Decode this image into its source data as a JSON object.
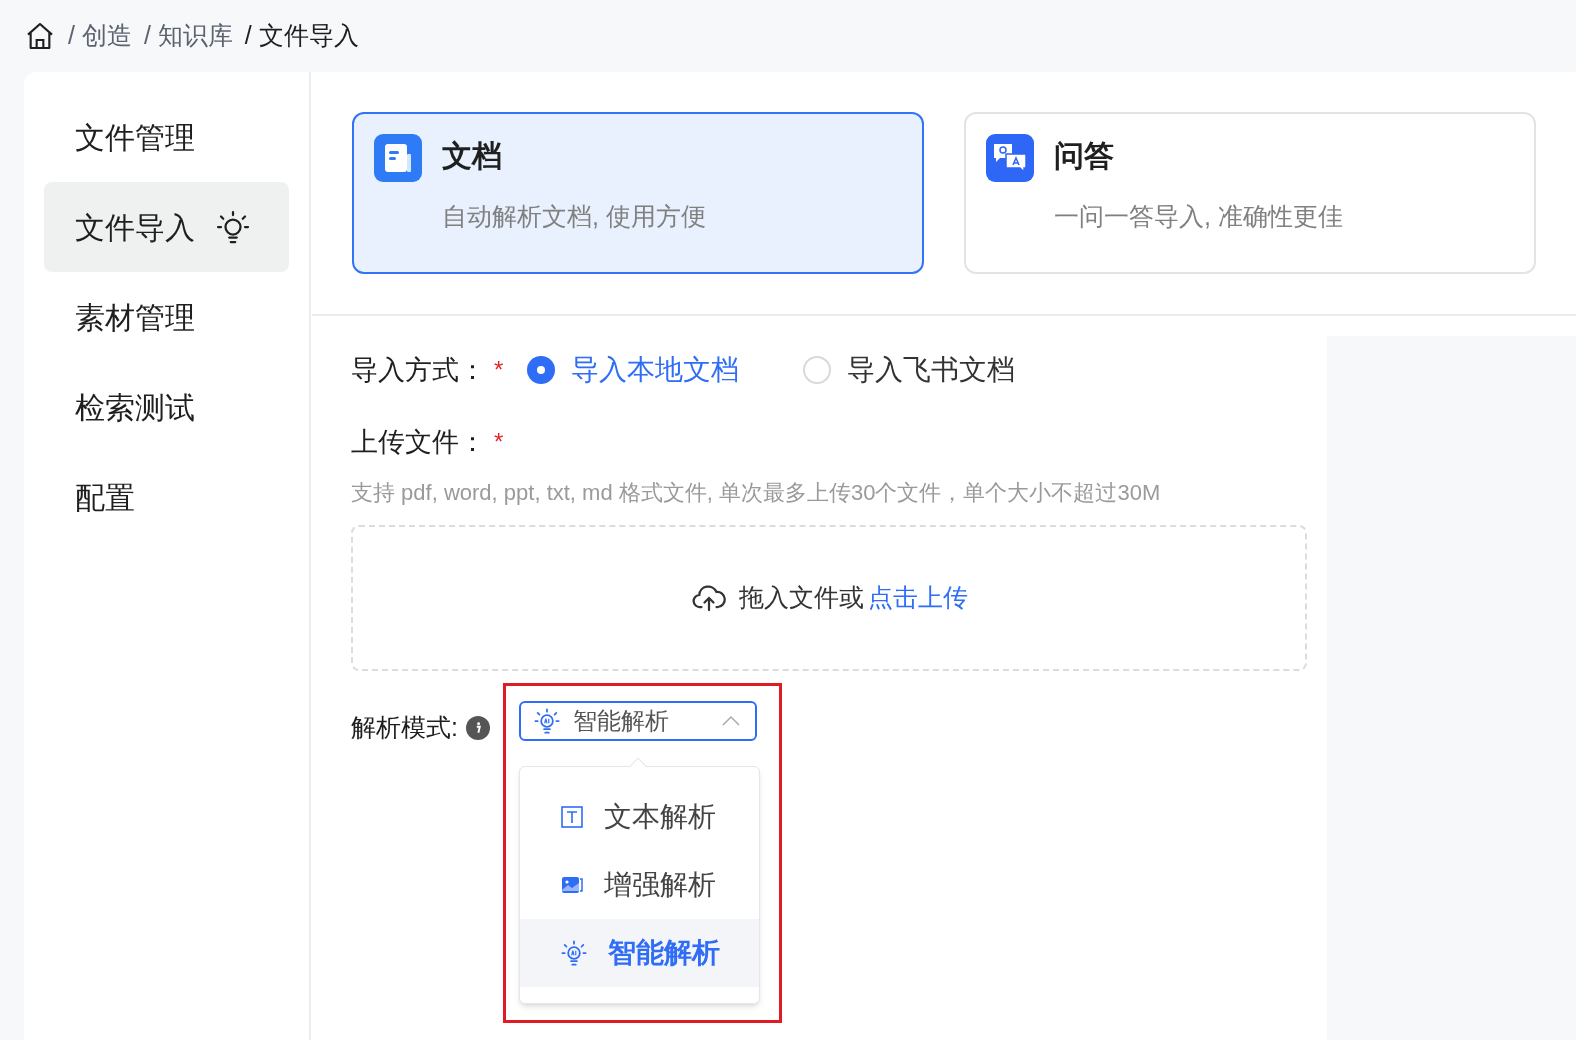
{
  "breadcrumb": [
    {
      "label": "/ 创造",
      "selected": false
    },
    {
      "label": "/ 知识库",
      "selected": false
    },
    {
      "label": "/ 文件导入",
      "selected": true
    }
  ],
  "sidebar": {
    "items": [
      {
        "label": "文件管理",
        "selected": false
      },
      {
        "label": "文件导入",
        "selected": true
      },
      {
        "label": "素材管理",
        "selected": false
      },
      {
        "label": "检索测试",
        "selected": false
      },
      {
        "label": "配置",
        "selected": false
      }
    ]
  },
  "cards": [
    {
      "kind": "document",
      "title": "文档",
      "description": "自动解析文档, 使用方便",
      "selected": true
    },
    {
      "kind": "qa",
      "title": "问答",
      "description": "一问一答导入, 准确性更佳",
      "selected": false
    }
  ],
  "import_method": {
    "label": "导入方式：",
    "required_mark": "*",
    "options": [
      {
        "label": "导入本地文档",
        "selected": true
      },
      {
        "label": "导入飞书文档",
        "selected": false
      }
    ]
  },
  "upload": {
    "label": "上传文件：",
    "required_mark": "*",
    "hint": "支持 pdf, word, ppt, txt, md 格式文件, 单次最多上传30个文件，单个大小不超过30M",
    "dropzone": {
      "text": "拖入文件或",
      "link": "点击上传"
    }
  },
  "parse_mode": {
    "label": "解析模式:",
    "select": {
      "value": "智能解析",
      "expanded": true
    },
    "options": [
      {
        "kind": "text",
        "label": "文本解析",
        "selected": false
      },
      {
        "kind": "enhanced",
        "label": "增强解析",
        "selected": false
      },
      {
        "kind": "smart",
        "label": "智能解析",
        "selected": true
      }
    ]
  }
}
